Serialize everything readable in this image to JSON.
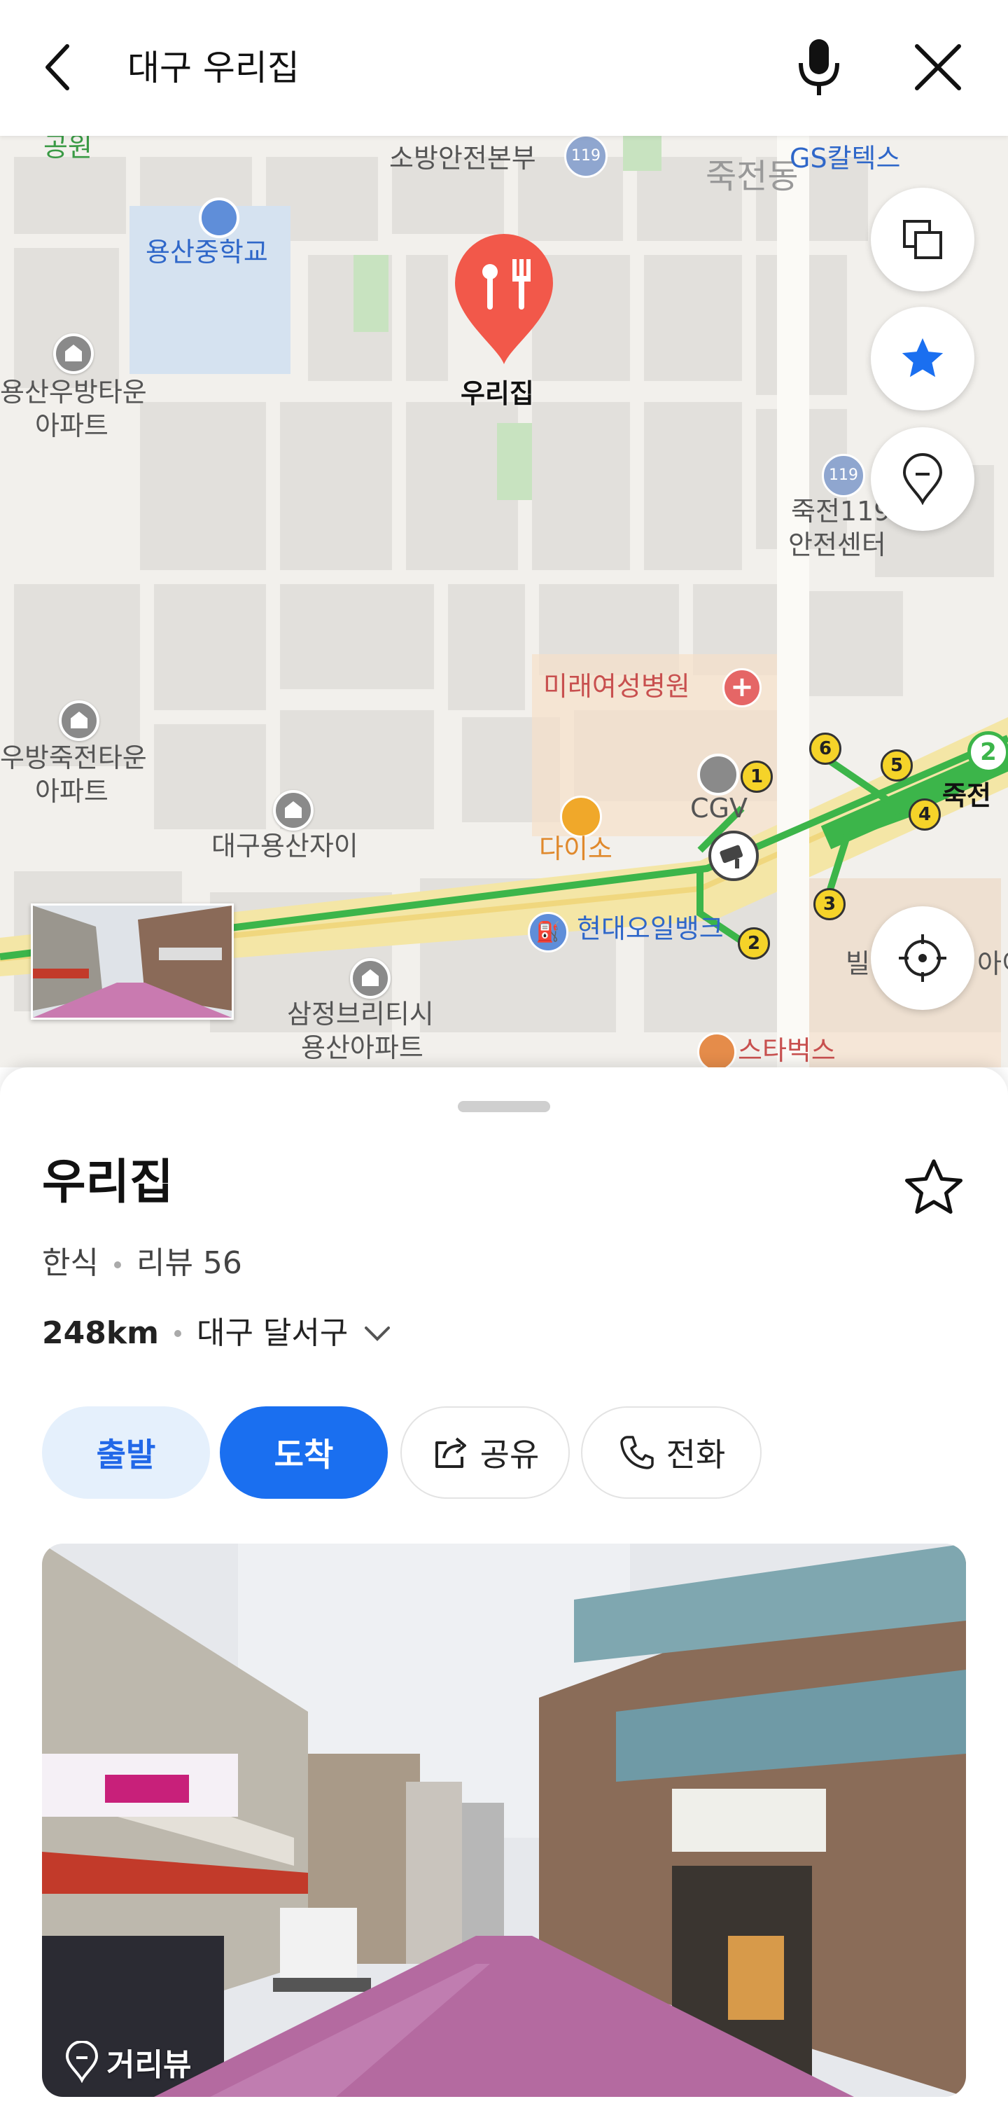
{
  "header": {
    "search_text": "대구 우리집"
  },
  "map": {
    "labels": {
      "fire_station": "소방안전본부",
      "school": "용산중학교",
      "gs": "GS칼텍스",
      "district": "죽전동",
      "apt1_line1": "용산우방타운",
      "apt1_line2": "아파트",
      "police": "죽전119",
      "police2": "안전센터",
      "hospital": "미래여성병원",
      "apt2_line1": "우방죽전타운",
      "apt2_line2": "아파트",
      "cgv": "CGV",
      "daiso": "다이소",
      "apt3": "대구용산자이",
      "oilbank": "현대오일뱅크",
      "apt4_line1": "삼정브리티시",
      "apt4_line2": "용산아파트",
      "starbucks": "스타벅스",
      "station": "죽전",
      "station_num": "2",
      "park": "공원",
      "villa": "빌",
      "right_edge": "아이"
    },
    "pin_label": "우리집",
    "exits": [
      "1",
      "2",
      "3",
      "4",
      "5",
      "6"
    ]
  },
  "sheet": {
    "name": "우리집",
    "category": "한식",
    "review": "리뷰 56",
    "distance": "248km",
    "address": "대구 달서구",
    "buttons": {
      "depart": "출발",
      "arrive": "도착",
      "share": "공유",
      "call": "전화"
    },
    "street_view_label": "거리뷰"
  },
  "colors": {
    "primary": "#1a6ff0",
    "pin": "#f2584a",
    "subway": "#3cb54a"
  }
}
